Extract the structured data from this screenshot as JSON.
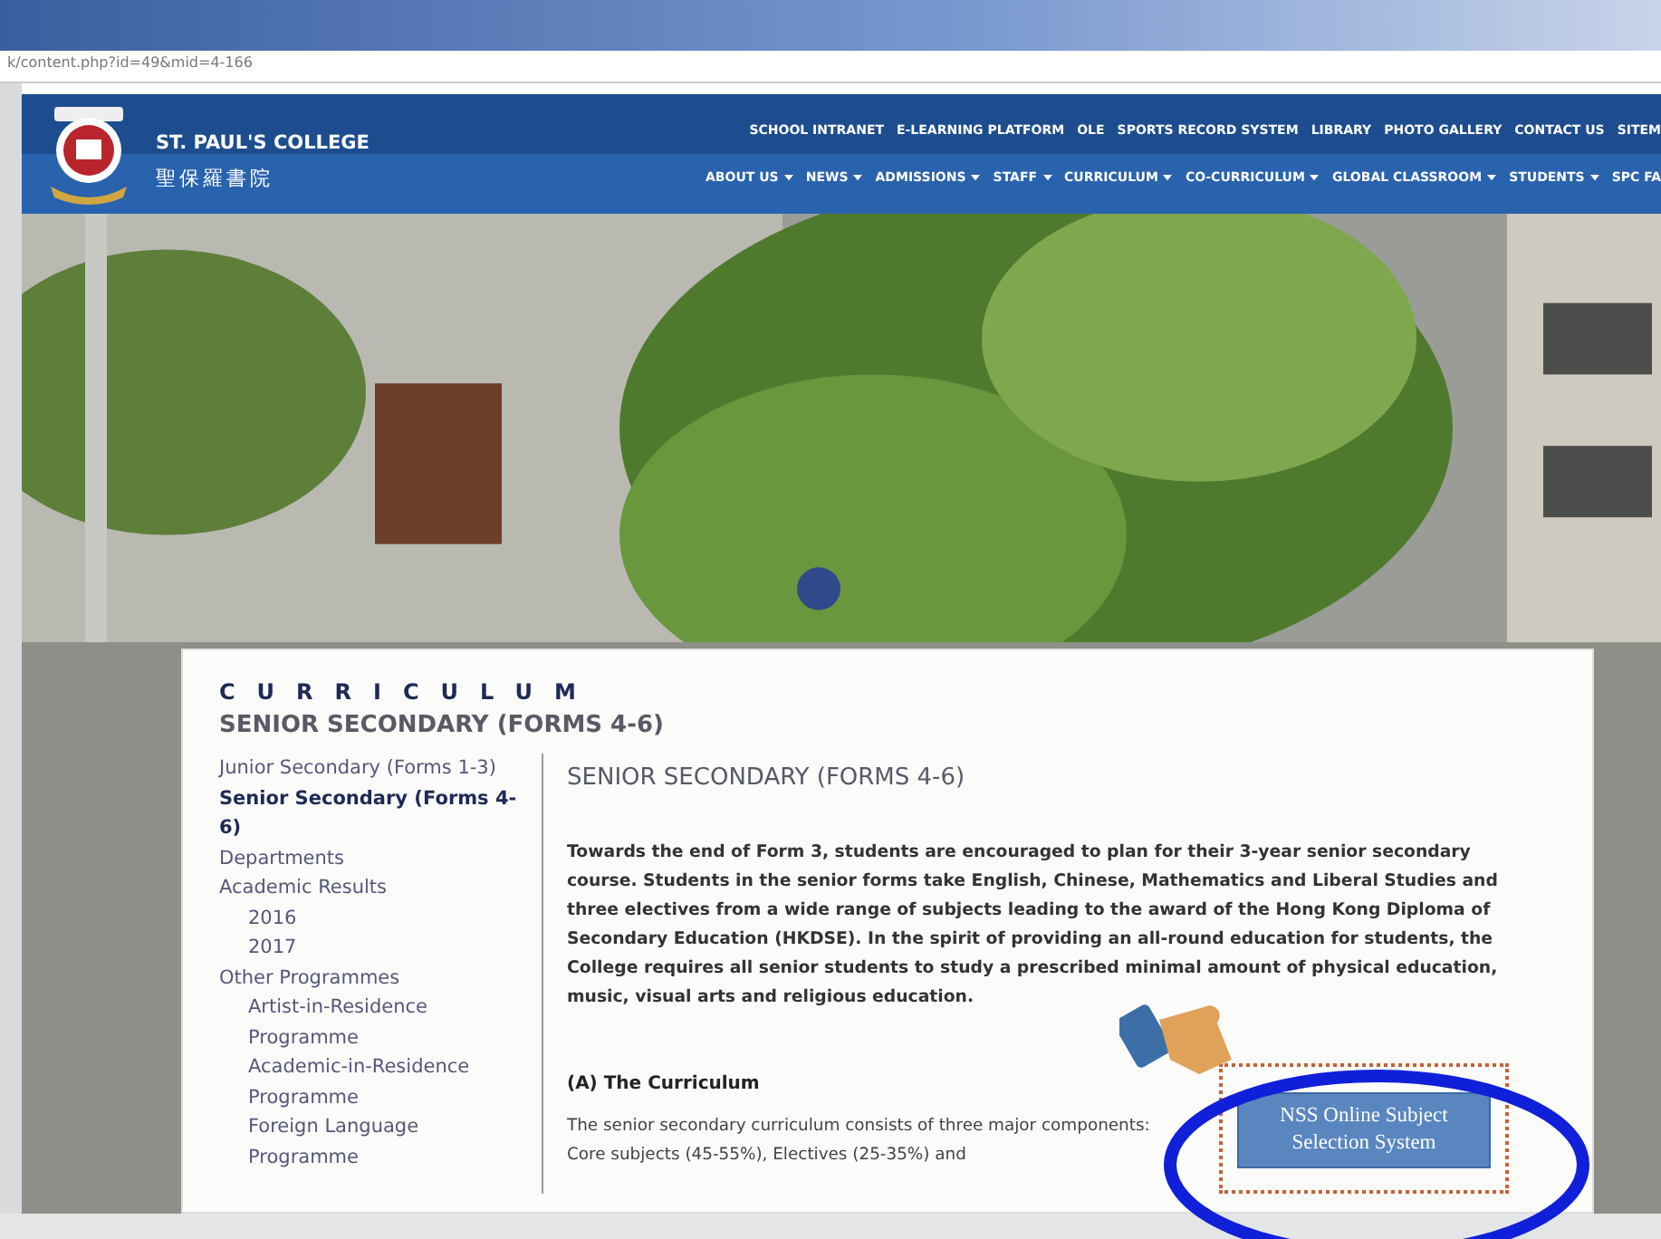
{
  "browser": {
    "url": "k/content.php?id=49&mid=4-166"
  },
  "header": {
    "school_name": "ST. PAUL'S COLLEGE",
    "school_name_chinese": "聖保羅書院",
    "top_links": [
      "SCHOOL INTRANET",
      "E-LEARNING PLATFORM",
      "OLE",
      "SPORTS RECORD SYSTEM",
      "LIBRARY",
      "PHOTO GALLERY",
      "CONTACT US",
      "SITEM"
    ],
    "main_menu": [
      {
        "label": "ABOUT US",
        "has_menu": true
      },
      {
        "label": "NEWS",
        "has_menu": true
      },
      {
        "label": "ADMISSIONS",
        "has_menu": true
      },
      {
        "label": "STAFF",
        "has_menu": true
      },
      {
        "label": "CURRICULUM",
        "has_menu": true
      },
      {
        "label": "CO-CURRICULUM",
        "has_menu": true
      },
      {
        "label": "GLOBAL CLASSROOM",
        "has_menu": true
      },
      {
        "label": "STUDENTS",
        "has_menu": true
      },
      {
        "label": "SPC FA",
        "has_menu": false
      }
    ]
  },
  "section": {
    "title": "CURRICULUM",
    "subtitle": "SENIOR SECONDARY (FORMS 4-6)"
  },
  "sidebar": {
    "items": [
      {
        "label": "Junior Secondary (Forms 1-3)",
        "selected": false
      },
      {
        "label": "Senior Secondary (Forms 4-6)",
        "selected": true
      },
      {
        "label": "Departments",
        "selected": false
      },
      {
        "label": "Academic Results",
        "selected": false,
        "children": [
          {
            "label": "2016",
            "selected": false
          },
          {
            "label": "2017",
            "selected": false
          }
        ]
      },
      {
        "label": "Other Programmes",
        "selected": false,
        "children": [
          {
            "label": "Artist-in-Residence Programme",
            "selected": false
          },
          {
            "label": "Academic-in-Residence Programme",
            "selected": false
          },
          {
            "label": "Foreign Language Programme",
            "selected": false
          }
        ]
      }
    ]
  },
  "article": {
    "heading": "SENIOR SECONDARY (FORMS 4-6)",
    "intro": "Towards the end of Form 3, students are encouraged to plan for their 3-year senior secondary course. Students in the senior forms take English, Chinese, Mathematics and Liberal Studies and three electives from a wide range of subjects leading to the award of the Hong Kong Diploma of Secondary Education (HKDSE).  In the spirit of providing an all-round education for students, the College requires all senior students to study a prescribed minimal amount of physical education, music, visual arts and religious education.",
    "subheading": "(A)  The Curriculum",
    "body": "The senior secondary curriculum consists of three major components: Core subjects (45-55%), Electives (25-35%) and",
    "button": "NSS Online Subject Selection System"
  }
}
